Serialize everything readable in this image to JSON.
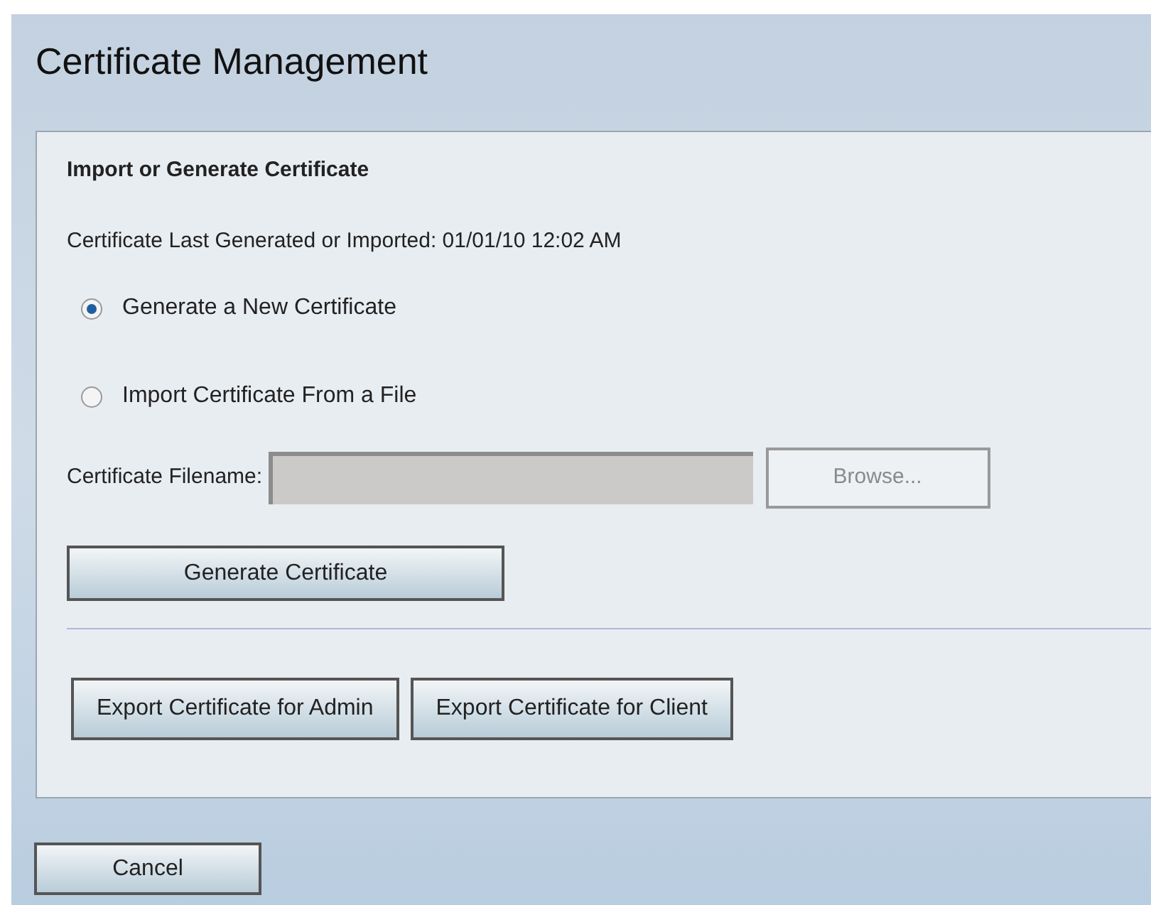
{
  "title": "Certificate Management",
  "panel": {
    "heading": "Import or Generate Certificate",
    "last_generated": "Certificate Last Generated or Imported: 01/01/10 12:02 AM",
    "options": [
      {
        "label": "Generate a New Certificate",
        "selected": true
      },
      {
        "label": "Import Certificate From a File",
        "selected": false
      }
    ],
    "filename": {
      "label": "Certificate Filename:",
      "disabled": true
    },
    "browse": {
      "label": "Browse...",
      "disabled": true
    },
    "generate_button": "Generate Certificate",
    "export_buttons": [
      "Export Certificate for Admin",
      "Export Certificate for Client"
    ]
  },
  "cancel_button": "Cancel"
}
